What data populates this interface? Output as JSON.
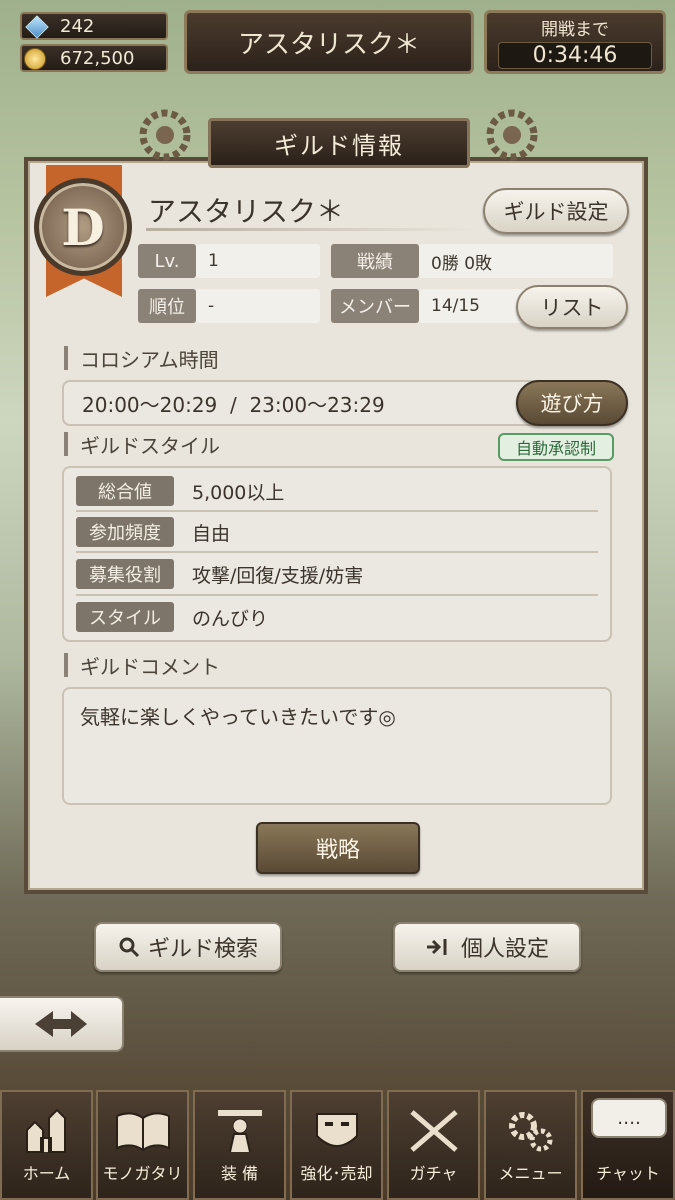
{
  "resources": {
    "gems": "242",
    "gold": "672,500"
  },
  "header": {
    "title": "アスタリスク＊",
    "countdown_label": "開戦まで",
    "countdown_time": "0:34:46"
  },
  "panel_title": "ギルド情報",
  "guild": {
    "rank_letter": "D",
    "name": "アスタリスク＊",
    "settings_button": "ギルド設定",
    "stats": {
      "level_label": "Lv.",
      "level_value": "1",
      "record_label": "戦績",
      "record_value": "0勝 0敗",
      "rank_label": "順位",
      "rank_value": "-",
      "member_label": "メンバー",
      "member_value": "14/15"
    },
    "list_button": "リスト"
  },
  "colosseum": {
    "heading": "コロシアム時間",
    "times": "20:00〜20:29  /  23:00〜23:29",
    "howto_button": "遊び方"
  },
  "style": {
    "heading": "ギルドスタイル",
    "badge": "自動承認制",
    "rows": [
      {
        "label": "総合値",
        "value": "5,000以上"
      },
      {
        "label": "参加頻度",
        "value": "自由"
      },
      {
        "label": "募集役割",
        "value": "攻撃/回復/支援/妨害"
      },
      {
        "label": "スタイル",
        "value": "のんびり"
      }
    ]
  },
  "comment": {
    "heading": "ギルドコメント",
    "text": "気軽に楽しくやっていきたいです◎"
  },
  "strategy_button": "戦略",
  "search_button": "ギルド検索",
  "personal_button": "個人設定",
  "nav": [
    {
      "label": "ホーム",
      "icon": "castle-icon"
    },
    {
      "label": "モノガタリ",
      "icon": "book-icon"
    },
    {
      "label": "装 備",
      "icon": "puppet-icon"
    },
    {
      "label": "強化･売却",
      "icon": "mask-icon"
    },
    {
      "label": "ガチャ",
      "icon": "swords-icon"
    },
    {
      "label": "メニュー",
      "icon": "gears-icon"
    }
  ],
  "chat": {
    "label": "チャット",
    "bubble": "…."
  }
}
